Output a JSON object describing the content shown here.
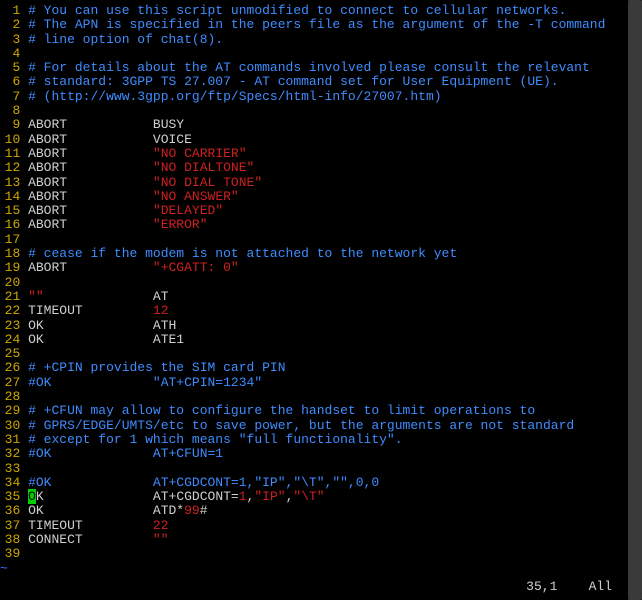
{
  "lines": [
    {
      "n": 1,
      "tokens": [
        {
          "t": "# You can use this script unmodified to connect to cellular networks.",
          "c": "cmt"
        }
      ]
    },
    {
      "n": 2,
      "tokens": [
        {
          "t": "# The APN is specified in the peers file as the argument of the -T command",
          "c": "cmt"
        }
      ]
    },
    {
      "n": 3,
      "tokens": [
        {
          "t": "# line option of chat(8).",
          "c": "cmt"
        }
      ]
    },
    {
      "n": 4,
      "tokens": []
    },
    {
      "n": 5,
      "tokens": [
        {
          "t": "# For details about the AT commands involved please consult the relevant",
          "c": "cmt"
        }
      ]
    },
    {
      "n": 6,
      "tokens": [
        {
          "t": "# standard: 3GPP TS 27.007 - AT command set for User Equipment (UE).",
          "c": "cmt"
        }
      ]
    },
    {
      "n": 7,
      "tokens": [
        {
          "t": "# (http://www.3gpp.org/ftp/Specs/html-info/27007.htm)",
          "c": "cmt"
        }
      ]
    },
    {
      "n": 8,
      "tokens": []
    },
    {
      "n": 9,
      "tokens": [
        {
          "t": "ABORT           BUSY",
          "c": "wht"
        }
      ]
    },
    {
      "n": 10,
      "tokens": [
        {
          "t": "ABORT           VOICE",
          "c": "wht"
        }
      ]
    },
    {
      "n": 11,
      "tokens": [
        {
          "t": "ABORT           ",
          "c": "wht"
        },
        {
          "t": "\"NO CARRIER\"",
          "c": "str"
        }
      ]
    },
    {
      "n": 12,
      "tokens": [
        {
          "t": "ABORT           ",
          "c": "wht"
        },
        {
          "t": "\"NO DIALTONE\"",
          "c": "str"
        }
      ]
    },
    {
      "n": 13,
      "tokens": [
        {
          "t": "ABORT           ",
          "c": "wht"
        },
        {
          "t": "\"NO DIAL TONE\"",
          "c": "str"
        }
      ]
    },
    {
      "n": 14,
      "tokens": [
        {
          "t": "ABORT           ",
          "c": "wht"
        },
        {
          "t": "\"NO ANSWER\"",
          "c": "str"
        }
      ]
    },
    {
      "n": 15,
      "tokens": [
        {
          "t": "ABORT           ",
          "c": "wht"
        },
        {
          "t": "\"DELAYED\"",
          "c": "str"
        }
      ]
    },
    {
      "n": 16,
      "tokens": [
        {
          "t": "ABORT           ",
          "c": "wht"
        },
        {
          "t": "\"ERROR\"",
          "c": "str"
        }
      ]
    },
    {
      "n": 17,
      "tokens": []
    },
    {
      "n": 18,
      "tokens": [
        {
          "t": "# cease if the modem is not attached to the network yet",
          "c": "cmt"
        }
      ]
    },
    {
      "n": 19,
      "tokens": [
        {
          "t": "ABORT           ",
          "c": "wht"
        },
        {
          "t": "\"+CGATT: 0\"",
          "c": "str"
        }
      ]
    },
    {
      "n": 20,
      "tokens": []
    },
    {
      "n": 21,
      "tokens": [
        {
          "t": "\"\"",
          "c": "str"
        },
        {
          "t": "              AT",
          "c": "wht"
        }
      ]
    },
    {
      "n": 22,
      "tokens": [
        {
          "t": "TIMEOUT         ",
          "c": "wht"
        },
        {
          "t": "12",
          "c": "num"
        }
      ]
    },
    {
      "n": 23,
      "tokens": [
        {
          "t": "OK              ATH",
          "c": "wht"
        }
      ]
    },
    {
      "n": 24,
      "tokens": [
        {
          "t": "OK              ATE1",
          "c": "wht"
        }
      ]
    },
    {
      "n": 25,
      "tokens": []
    },
    {
      "n": 26,
      "tokens": [
        {
          "t": "# +CPIN provides the SIM card PIN",
          "c": "cmt"
        }
      ]
    },
    {
      "n": 27,
      "tokens": [
        {
          "t": "#OK             \"AT+CPIN=1234\"",
          "c": "cmt"
        }
      ]
    },
    {
      "n": 28,
      "tokens": []
    },
    {
      "n": 29,
      "tokens": [
        {
          "t": "# +CFUN may allow to configure the handset to limit operations to",
          "c": "cmt"
        }
      ]
    },
    {
      "n": 30,
      "tokens": [
        {
          "t": "# GPRS/EDGE/UMTS/etc to save power, but the arguments are not standard",
          "c": "cmt"
        }
      ]
    },
    {
      "n": 31,
      "tokens": [
        {
          "t": "# except for 1 which means \"full functionality\".",
          "c": "cmt"
        }
      ]
    },
    {
      "n": 32,
      "tokens": [
        {
          "t": "#OK             AT+CFUN=1",
          "c": "cmt"
        }
      ]
    },
    {
      "n": 33,
      "tokens": []
    },
    {
      "n": 34,
      "tokens": [
        {
          "t": "#OK             AT+CGDCONT=1,\"IP\",\"\\T\",\"\",0,0",
          "c": "cmt"
        }
      ]
    },
    {
      "n": 35,
      "tokens": [
        {
          "t": "O",
          "c": "cursor"
        },
        {
          "t": "K              AT+CGDCONT=",
          "c": "wht"
        },
        {
          "t": "1",
          "c": "num"
        },
        {
          "t": ",",
          "c": "wht"
        },
        {
          "t": "\"IP\"",
          "c": "str"
        },
        {
          "t": ",",
          "c": "wht"
        },
        {
          "t": "\"\\T\"",
          "c": "str"
        }
      ]
    },
    {
      "n": 36,
      "tokens": [
        {
          "t": "OK              ATD*",
          "c": "wht"
        },
        {
          "t": "99",
          "c": "num"
        },
        {
          "t": "#",
          "c": "wht"
        }
      ]
    },
    {
      "n": 37,
      "tokens": [
        {
          "t": "TIMEOUT         ",
          "c": "wht"
        },
        {
          "t": "22",
          "c": "num"
        }
      ]
    },
    {
      "n": 38,
      "tokens": [
        {
          "t": "CONNECT         ",
          "c": "wht"
        },
        {
          "t": "\"\"",
          "c": "str"
        }
      ]
    },
    {
      "n": 39,
      "tokens": []
    }
  ],
  "tildes": [
    "~",
    "~"
  ],
  "status": {
    "pos": "35,1",
    "scroll": "All"
  }
}
